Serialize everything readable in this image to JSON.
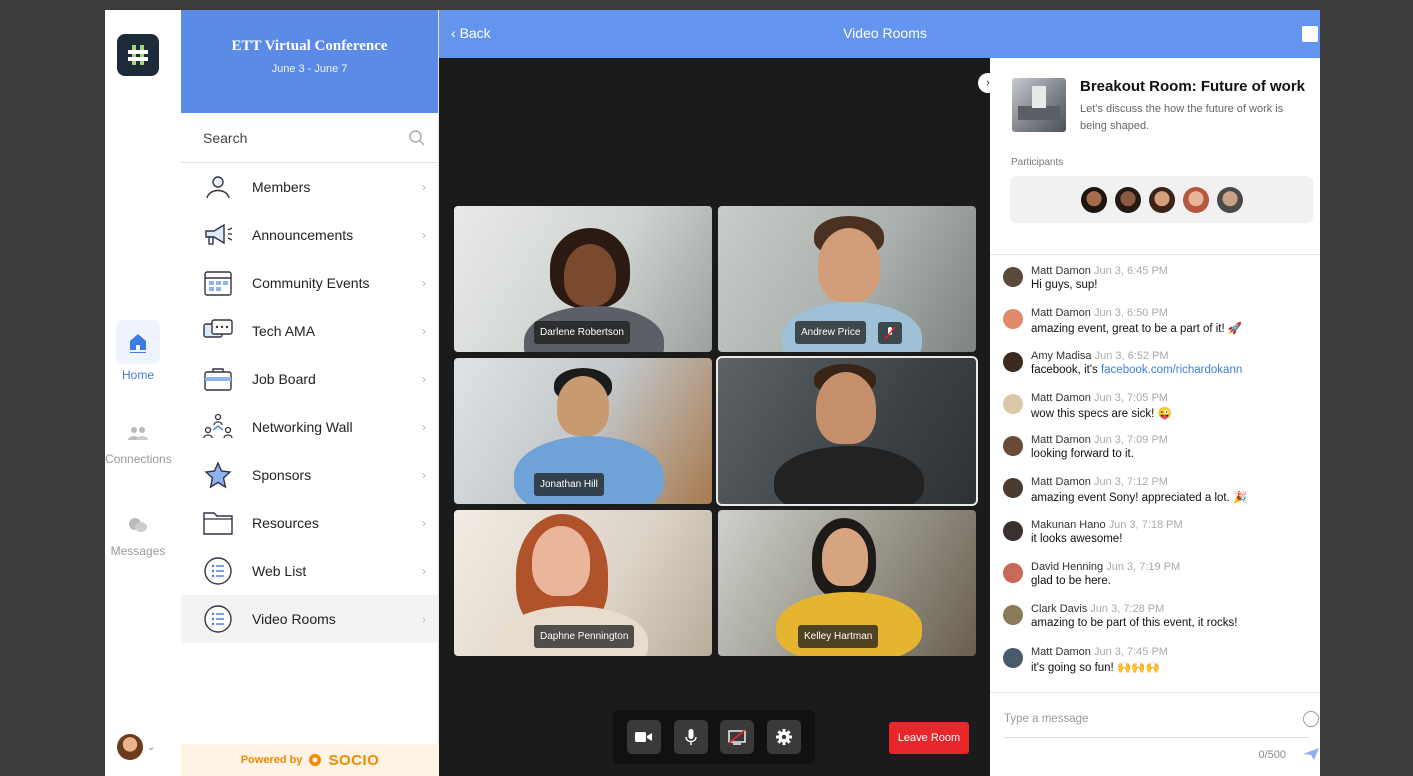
{
  "rail": {
    "home_label": "Home",
    "connections_label": "Connections",
    "messages_label": "Messages"
  },
  "nav": {
    "title": "ETT Virtual Conference",
    "dates": "June 3 - June 7",
    "search_placeholder": "Search",
    "items": [
      {
        "label": "Members",
        "icon": "members-icon"
      },
      {
        "label": "Announcements",
        "icon": "megaphone-icon"
      },
      {
        "label": "Community Events",
        "icon": "calendar-icon"
      },
      {
        "label": "Tech AMA",
        "icon": "chat-bubbles-icon"
      },
      {
        "label": "Job Board",
        "icon": "briefcase-icon"
      },
      {
        "label": "Networking Wall",
        "icon": "network-icon"
      },
      {
        "label": "Sponsors",
        "icon": "star-icon"
      },
      {
        "label": "Resources",
        "icon": "folder-icon"
      },
      {
        "label": "Web List",
        "icon": "list-icon"
      },
      {
        "label": "Video Rooms",
        "icon": "list-icon"
      }
    ],
    "powered_by": "Powered by",
    "brand": "SOCIO"
  },
  "topbar": {
    "back_label": "Back",
    "title": "Video Rooms"
  },
  "video": {
    "tiles": [
      {
        "name": "Darlene Robertson"
      },
      {
        "name": "Andrew Price"
      },
      {
        "name": "Jonathan Hill"
      },
      {
        "name": ""
      },
      {
        "name": "Daphne Pennington"
      },
      {
        "name": "Kelley Hartman"
      }
    ],
    "leave_label": "Leave Room"
  },
  "room": {
    "title": "Breakout Room: Future of work",
    "description": "Let's discuss the how the future of work is being shaped.",
    "participants_label": "Participants"
  },
  "chat": {
    "messages": [
      {
        "author": "Matt Damon",
        "time": "Jun 3, 6:45 PM",
        "text": "Hi guys, sup!"
      },
      {
        "author": "Matt Damon",
        "time": "Jun 3, 6:50 PM",
        "text": "amazing event, great to be a part of it! 🚀"
      },
      {
        "author": "Amy Madisa",
        "time": "Jun 3, 6:52 PM",
        "text": "facebook, it's ",
        "link": "facebook.com/richardokann"
      },
      {
        "author": "Matt Damon",
        "time": "Jun 3, 7:05 PM",
        "text": "wow this specs are sick! 😜"
      },
      {
        "author": "Matt Damon",
        "time": "Jun 3, 7:09 PM",
        "text": "looking forward to it."
      },
      {
        "author": "Matt Damon",
        "time": "Jun 3, 7:12 PM",
        "text": "amazing event Sony! appreciated a lot. 🎉"
      },
      {
        "author": "Makunan Hano",
        "time": "Jun 3, 7:18 PM",
        "text": "it looks awesome!"
      },
      {
        "author": "David Henning",
        "time": "Jun 3, 7:19 PM",
        "text": "glad to be here."
      },
      {
        "author": "Clark Davis",
        "time": "Jun 3, 7:28 PM",
        "text": "amazing to be part of this event, it rocks!"
      },
      {
        "author": "Matt Damon",
        "time": "Jun 3, 7:45 PM",
        "text": "it's going so fun! 🙌🙌🙌"
      }
    ],
    "input_placeholder": "Type a message",
    "char_count": "0/500"
  },
  "colors": {
    "accent": "#6395ee",
    "nav_header": "#5b8be6",
    "leave": "#e8262b",
    "brand": "#f08a00"
  }
}
